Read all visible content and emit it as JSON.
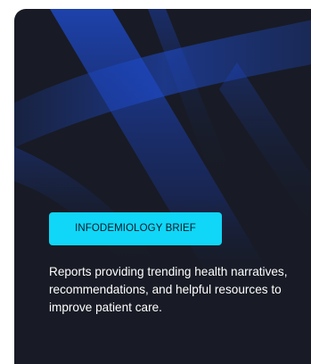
{
  "card": {
    "badge_label": "INFODEMIOLOGY BRIEF",
    "description": "Reports providing trending health narratives, recommendations, and helpful resources to improve patient care.",
    "colors": {
      "background": "#181b25",
      "badge": "#10d6f7",
      "accent_lines": "#1e4fd6"
    }
  }
}
